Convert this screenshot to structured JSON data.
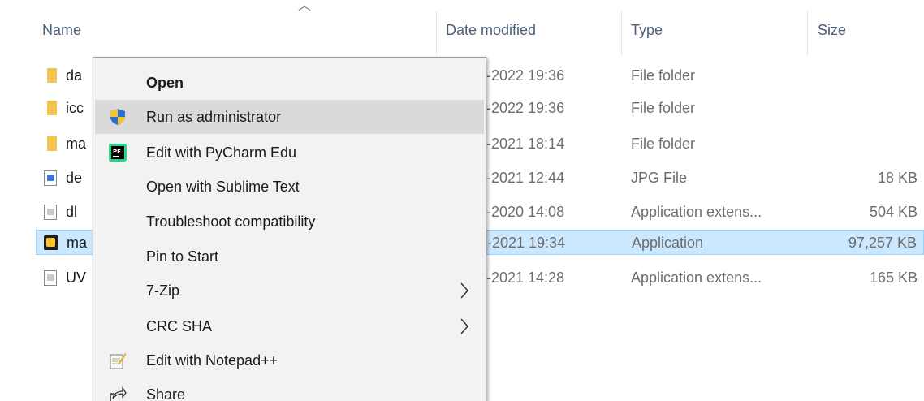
{
  "columns": {
    "name": "Name",
    "date_modified": "Date modified",
    "type": "Type",
    "size": "Size"
  },
  "files": [
    {
      "name": "da",
      "date": "-2022 19:36",
      "type": "File folder",
      "size": "",
      "icon": "folder-icon"
    },
    {
      "name": "icc",
      "date": "-2022 19:36",
      "type": "File folder",
      "size": "",
      "icon": "folder-icon"
    },
    {
      "name": "ma",
      "date": "-2021 18:14",
      "type": "File folder",
      "size": "",
      "icon": "folder-icon"
    },
    {
      "name": "de",
      "date": "-2021 12:44",
      "type": "JPG File",
      "size": "18 KB",
      "icon": "image-file-icon"
    },
    {
      "name": "dl",
      "date": "-2020 14:08",
      "type": "Application extens...",
      "size": "504 KB",
      "icon": "dll-file-icon"
    },
    {
      "name": "ma",
      "date": "-2021 19:34",
      "type": "Application",
      "size": "97,257 KB",
      "icon": "application-icon",
      "selected": true
    },
    {
      "name": "UV",
      "date": "-2021 14:28",
      "type": "Application extens...",
      "size": "165 KB",
      "icon": "dll-file-icon"
    }
  ],
  "context_menu": {
    "items": [
      {
        "label": "Open",
        "bold": true,
        "icon": ""
      },
      {
        "label": "Run as administrator",
        "icon": "uac-shield-icon",
        "hover": true
      },
      {
        "label": "Edit with PyCharm Edu",
        "icon": "pycharm-icon"
      },
      {
        "label": "Open with Sublime Text",
        "icon": ""
      },
      {
        "label": "Troubleshoot compatibility",
        "icon": ""
      },
      {
        "label": "Pin to Start",
        "icon": ""
      },
      {
        "label": "7-Zip",
        "icon": "",
        "submenu": true
      },
      {
        "label": "CRC SHA",
        "icon": "",
        "submenu": true
      },
      {
        "label": "Edit with Notepad++",
        "icon": "notepad-plus-plus-icon"
      },
      {
        "label": "Share",
        "icon": "share-icon"
      }
    ]
  },
  "colors": {
    "selected_row_bg": "#cce8ff",
    "menu_bg": "#f2f2f2",
    "menu_hover_bg": "#dadada",
    "header_text": "#4c607a"
  }
}
